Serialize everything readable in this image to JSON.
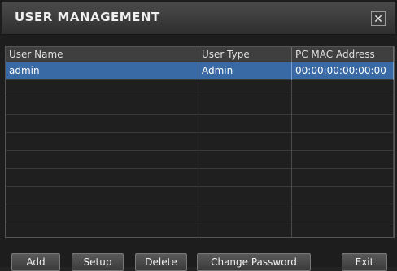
{
  "window": {
    "title": "USER MANAGEMENT",
    "close_glyph": "✕"
  },
  "table": {
    "columns": [
      "User Name",
      "User Type",
      "PC MAC Address"
    ],
    "rows": [
      [
        "admin",
        "Admin",
        "00:00:00:00:00:00"
      ],
      [
        "",
        "",
        ""
      ],
      [
        "",
        "",
        ""
      ],
      [
        "",
        "",
        ""
      ],
      [
        "",
        "",
        ""
      ],
      [
        "",
        "",
        ""
      ],
      [
        "",
        "",
        ""
      ],
      [
        "",
        "",
        ""
      ],
      [
        "",
        "",
        ""
      ],
      [
        "",
        "",
        ""
      ]
    ],
    "selected_row": 0
  },
  "buttons": {
    "add": "Add",
    "setup": "Setup",
    "delete": "Delete",
    "change_password": "Change Password",
    "exit": "Exit"
  },
  "colors": {
    "selection": "#3a6aa6",
    "background": "#1d1d1d"
  }
}
